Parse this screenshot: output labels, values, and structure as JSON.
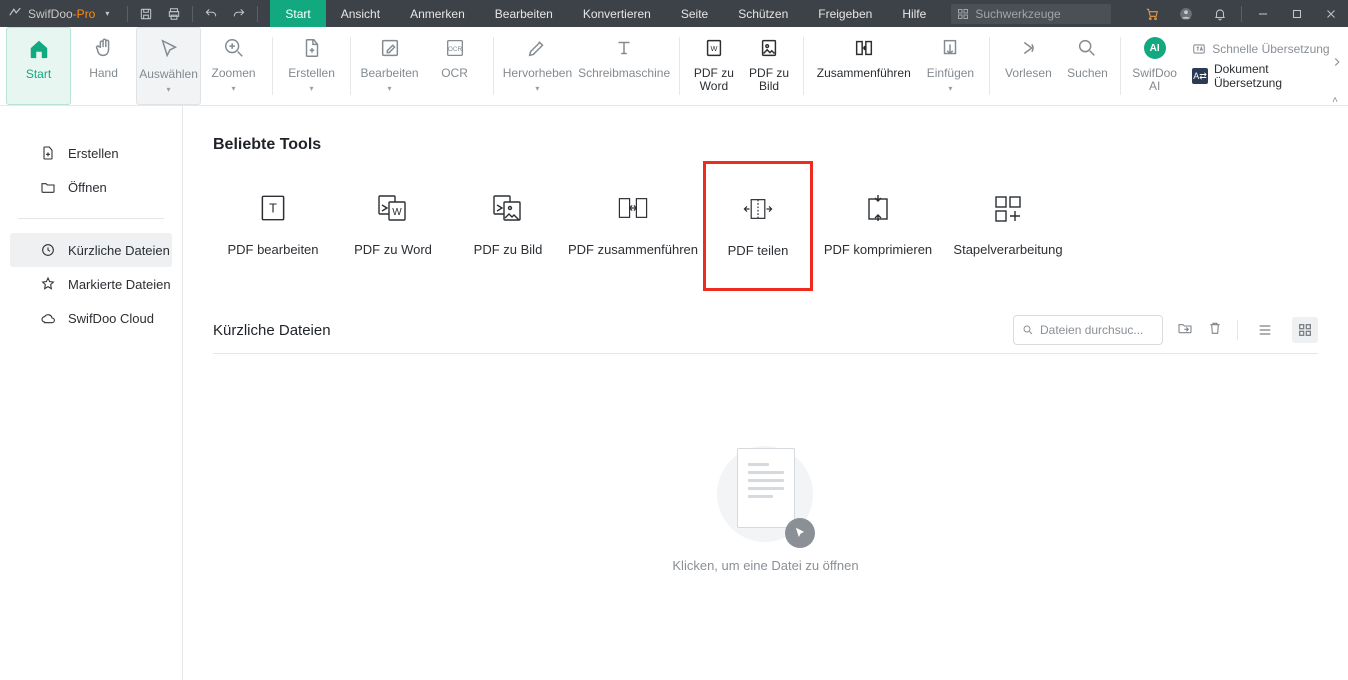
{
  "app": {
    "name": "SwifDoo",
    "suffix": "-Pro"
  },
  "menu": {
    "items": [
      "Start",
      "Ansicht",
      "Anmerken",
      "Bearbeiten",
      "Konvertieren",
      "Seite",
      "Schützen",
      "Freigeben",
      "Hilfe"
    ],
    "activeIndex": 0
  },
  "searchTools": {
    "placeholder": "Suchwerkzeuge"
  },
  "ribbon": {
    "start": "Start",
    "hand": "Hand",
    "select": "Auswählen",
    "zoom": "Zoomen",
    "create": "Erstellen",
    "edit": "Bearbeiten",
    "ocr": "OCR",
    "highlight": "Hervorheben",
    "typewriter": "Schreibmaschine",
    "pdf2word": "PDF zu Word",
    "pdf2img": "PDF zu Bild",
    "merge": "Zusammenführen",
    "insert": "Einfügen",
    "read": "Vorlesen",
    "search": "Suchen",
    "ai": "SwifDoo AI",
    "quickTranslate": "Schnelle Übersetzung",
    "docTranslate": "Dokument Übersetzung"
  },
  "sidebar": {
    "create": "Erstellen",
    "open": "Öffnen",
    "recent": "Kürzliche Dateien",
    "marked": "Markierte Dateien",
    "cloud": "SwifDoo Cloud"
  },
  "sections": {
    "popularTools": "Beliebte Tools",
    "recentFiles": "Kürzliche Dateien"
  },
  "tools": {
    "editPdf": "PDF bearbeiten",
    "pdf2word": "PDF zu Word",
    "pdf2img": "PDF zu Bild",
    "merge": "PDF zusammenführen",
    "split": "PDF teilen",
    "compress": "PDF komprimieren",
    "batch": "Stapelverarbeitung"
  },
  "fileSearch": {
    "placeholder": "Dateien durchsuc..."
  },
  "empty": {
    "text": "Klicken, um eine Datei zu öffnen"
  }
}
